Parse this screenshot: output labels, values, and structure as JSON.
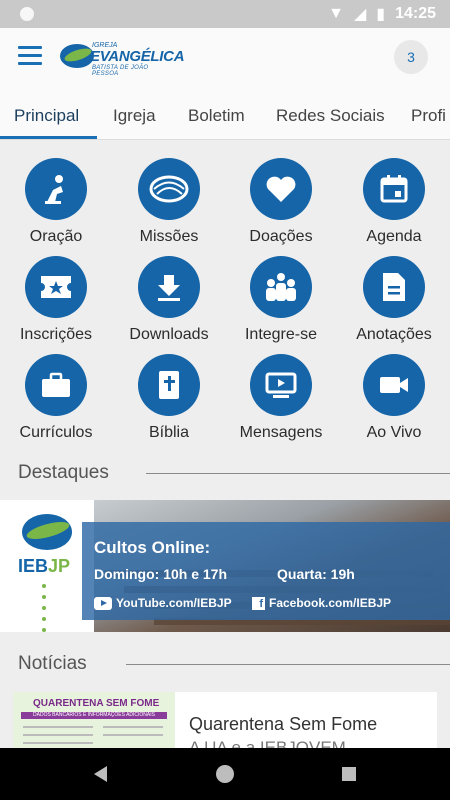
{
  "status_bar": {
    "time": "14:25"
  },
  "app_bar": {
    "logo_top": "IGREJA",
    "logo_main": "EVANGÉLICA",
    "logo_bottom": "BATISTA DE JOÃO PESSOA",
    "notification_count": "3"
  },
  "tabs": [
    "Principal",
    "Igreja",
    "Boletim",
    "Redes Sociais",
    "Profi"
  ],
  "grid": [
    {
      "label": "Oração",
      "icon": "pray-icon"
    },
    {
      "label": "Missões",
      "icon": "globe-icon"
    },
    {
      "label": "Doações",
      "icon": "heart-icon"
    },
    {
      "label": "Agenda",
      "icon": "calendar-icon"
    },
    {
      "label": "Inscrições",
      "icon": "ticket-icon"
    },
    {
      "label": "Downloads",
      "icon": "download-icon"
    },
    {
      "label": "Integre-se",
      "icon": "group-icon"
    },
    {
      "label": "Anotações",
      "icon": "document-icon"
    },
    {
      "label": "Currículos",
      "icon": "briefcase-icon"
    },
    {
      "label": "Bíblia",
      "icon": "bible-icon"
    },
    {
      "label": "Mensagens",
      "icon": "video-play-icon"
    },
    {
      "label": "Ao Vivo",
      "icon": "camera-icon"
    }
  ],
  "destaques": {
    "title": "Destaques",
    "banner": {
      "brand_a": "IEB",
      "brand_b": "JP",
      "heading": "Cultos Online:",
      "line1": "Domingo: 10h e 17h",
      "line2": "Quarta: 19h",
      "youtube": "YouTube.com/IEBJP",
      "facebook": "Facebook.com/IEBJP"
    }
  },
  "noticias": {
    "title": "Notícias",
    "item": {
      "thumb_title": "QUARENTENA SEM FOME",
      "thumb_subtitle": "DADOS BANCÁRIOS E INFORMAÇÕES ADICIONAIS",
      "title": "Quarentena Sem Fome",
      "snippet": "A UA e a IEBJOVEM"
    }
  },
  "colors": {
    "primary": "#1565a8",
    "accent_green": "#7ab648",
    "banner_overlay": "#2e69a5"
  }
}
